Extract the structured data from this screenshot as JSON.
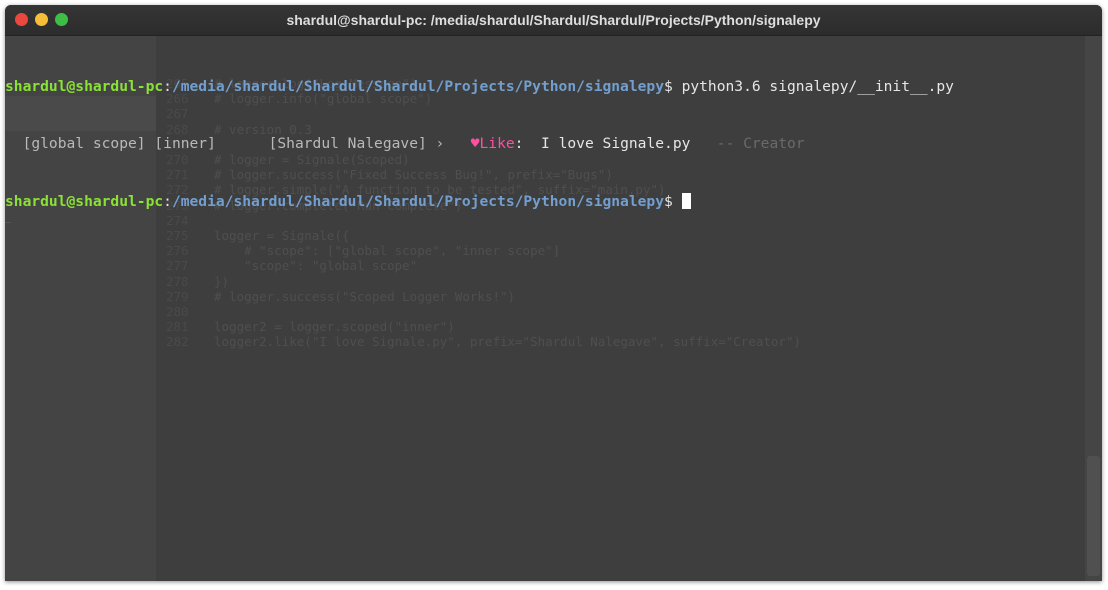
{
  "window": {
    "title": "shardul@shardul-pc: /media/shardul/Shardul/Shardul/Projects/Python/signalepy"
  },
  "terminal": {
    "line1": {
      "user": "shardul@shardul-pc",
      "colon": ":",
      "path": "/media/shardul/Shardul/Shardul/Projects/Python/signalepy",
      "prompt": "$ ",
      "command": "python3.6 signalepy/__init__.py"
    },
    "line2": {
      "scope1": "  [global scope]",
      "scope2": " [inner]",
      "prefix": "[Shardul Nalegave]",
      "arrow": " › ",
      "heart": "♥",
      "like": "Like",
      "colon": ":",
      "message": "  I love Signale.py",
      "suffix": "   -- Creator"
    },
    "line3": {
      "user": "shardul@shardul-pc",
      "colon": ":",
      "path": "/media/shardul/Shardul/Shardul/Projects/Python/signalepy",
      "prompt": "$ "
    }
  },
  "background_code": [
    {
      "ln": "265",
      "text": "# logger.log(\"Log Message\")"
    },
    {
      "ln": "266",
      "text": "# logger.info(\"global scope\")"
    },
    {
      "ln": "267",
      "text": ""
    },
    {
      "ln": "268",
      "text": "# version 0.3"
    },
    {
      "ln": "269",
      "text": ""
    },
    {
      "ln": "270",
      "text": "# logger = Signale(Scoped)"
    },
    {
      "ln": "271",
      "text": "# logger.success(\"Fixed Success Bug!\", prefix=\"Bugs\")"
    },
    {
      "ln": "272",
      "text": "# logger.simple(\"A function to be tested\", suffix=\"main.py\")"
    },
    {
      "ln": "273",
      "text": "# logger.complete(\"Run Complete\")"
    },
    {
      "ln": "274",
      "text": ""
    },
    {
      "ln": "275",
      "text": "logger = Signale({"
    },
    {
      "ln": "276",
      "text": "    # \"scope\": [\"global scope\", \"inner scope\"]"
    },
    {
      "ln": "277",
      "text": "    \"scope\": \"global scope\""
    },
    {
      "ln": "278",
      "text": "})"
    },
    {
      "ln": "279",
      "text": "# logger.success(\"Scoped Logger Works!\")"
    },
    {
      "ln": "280",
      "text": ""
    },
    {
      "ln": "281",
      "text": "logger2 = logger.scoped(\"inner\")"
    },
    {
      "ln": "282",
      "text": "logger2.like(\"I love Signale.py\", prefix=\"Shardul Nalegave\", suffix=\"Creator\")"
    }
  ]
}
